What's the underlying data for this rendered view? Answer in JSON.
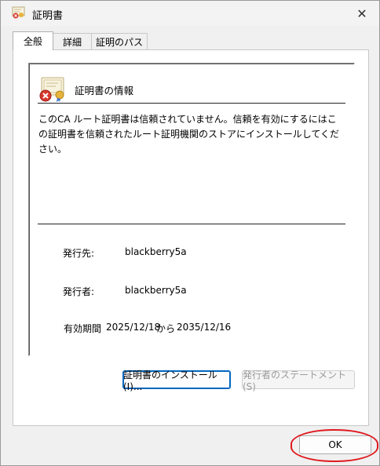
{
  "window": {
    "title": "証明書",
    "close_glyph": "✕"
  },
  "tabs": [
    {
      "label": "全般",
      "active": true
    },
    {
      "label": "詳細",
      "active": false
    },
    {
      "label": "証明のパス",
      "active": false
    }
  ],
  "info": {
    "heading": "証明書の情報",
    "message": "このCA ルート証明書は信頼されていません。信頼を有効にするにはこの証明書を信頼されたルート証明機関のストアにインストールしてください。",
    "issued_to_label": "発行先:",
    "issued_to_value": "blackberry5a",
    "issued_by_label": "発行者:",
    "issued_by_value": "blackberry5a",
    "validity_label": "有効期間",
    "valid_from": "2025/12/18",
    "validity_from_word": "から",
    "valid_to": "2035/12/16"
  },
  "buttons": {
    "install": "証明書のインストール(I)...",
    "issuer_statement": "発行者のステートメント(S)",
    "ok": "OK"
  },
  "colors": {
    "highlight": "#e0191e",
    "focus_border": "#0067c0"
  }
}
